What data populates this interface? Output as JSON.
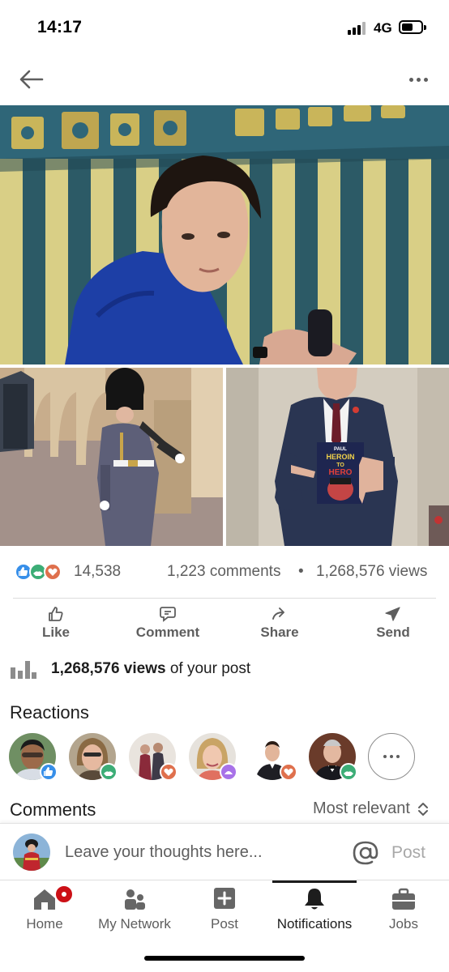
{
  "status_bar": {
    "time": "14:17",
    "network": "4G"
  },
  "header": {
    "back_icon": "arrow-left-icon",
    "more_icon": "more-horizontal-icon"
  },
  "post_media": {
    "photos": [
      {
        "name": "young-man-photo"
      },
      {
        "name": "royal-guard-photo"
      },
      {
        "name": "man-in-suit-with-book-photo"
      }
    ],
    "book_cover_text": [
      "PAUL",
      "HEROIN",
      "TO",
      "HERO"
    ]
  },
  "social_counts": {
    "reaction_icons": [
      "like-reaction-icon",
      "support-reaction-icon",
      "love-reaction-icon"
    ],
    "reactions": "14,538",
    "comments": "1,223 comments",
    "separator": "•",
    "views": "1,268,576 views"
  },
  "actions": [
    {
      "label": "Like",
      "icon": "thumbs-up-icon"
    },
    {
      "label": "Comment",
      "icon": "comment-icon"
    },
    {
      "label": "Share",
      "icon": "share-arrow-icon"
    },
    {
      "label": "Send",
      "icon": "send-icon"
    }
  ],
  "analytics": {
    "count": "1,268,576 views",
    "suffix": " of your post",
    "icon": "bar-chart-icon"
  },
  "reactions_section": {
    "title": "Reactions",
    "reactors": [
      {
        "badge": "like"
      },
      {
        "badge": "support"
      },
      {
        "badge": "love"
      },
      {
        "badge": "insightful"
      },
      {
        "badge": "love"
      },
      {
        "badge": "support"
      }
    ],
    "more_icon": "more-horizontal-icon"
  },
  "comments_section": {
    "title": "Comments",
    "sort": "Most relevant"
  },
  "composer": {
    "placeholder": "Leave your thoughts here...",
    "mention_icon": "at-sign-icon",
    "post_label": "Post"
  },
  "tab_bar": {
    "tabs": [
      {
        "label": "Home",
        "icon": "home-icon",
        "has_badge": true
      },
      {
        "label": "My Network",
        "icon": "people-icon"
      },
      {
        "label": "Post",
        "icon": "plus-square-icon"
      },
      {
        "label": "Notifications",
        "icon": "bell-icon",
        "active": true
      },
      {
        "label": "Jobs",
        "icon": "briefcase-icon"
      }
    ]
  },
  "colors": {
    "like": "#378fe9",
    "support": "#3cad76",
    "love": "#df704d",
    "insightful": "#a872e8",
    "badge": "#cc1016",
    "text_secondary": "#5e5e5e"
  }
}
